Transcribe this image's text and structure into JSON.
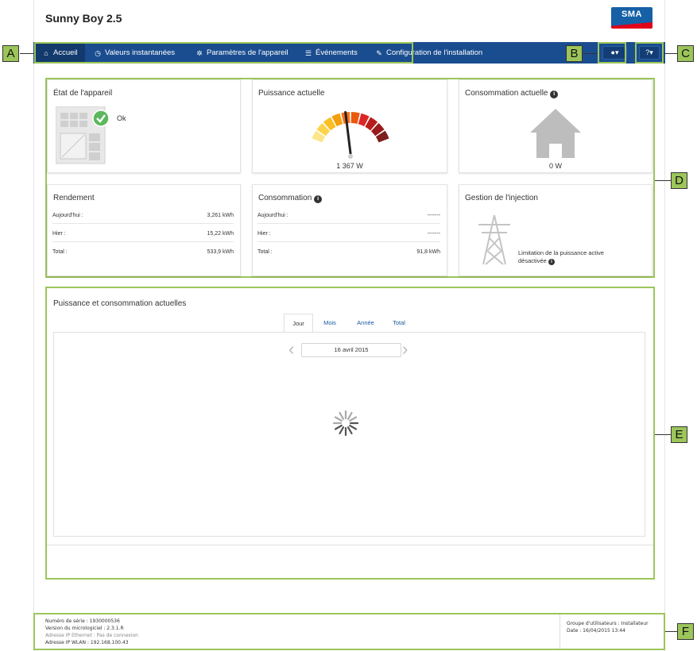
{
  "app": {
    "title": "Sunny Boy 2.5",
    "logo_text": "SMA"
  },
  "nav": {
    "items": [
      {
        "label": "Accueil",
        "icon": "home-icon",
        "active": true
      },
      {
        "label": "Valeurs instantanées",
        "icon": "clock-icon"
      },
      {
        "label": "Paramètres de l'appareil",
        "icon": "gear-icon"
      },
      {
        "label": "Événements",
        "icon": "list-icon"
      },
      {
        "label": "Configuration de l'installation",
        "icon": "wrench-icon"
      }
    ],
    "user_menu": "user-icon",
    "help_menu": "help-icon"
  },
  "callouts": [
    "A",
    "B",
    "C",
    "D",
    "E",
    "F"
  ],
  "tiles": {
    "device_state": {
      "title": "État de l'appareil",
      "status": "Ok",
      "icon": "check-circle-icon"
    },
    "current_power": {
      "title": "Puissance actuelle",
      "value": "1 367 W",
      "gauge_fraction": 0.45
    },
    "current_consumption": {
      "title": "Consommation actuelle",
      "info_icon": "info-icon",
      "value": "0 W"
    },
    "yield": {
      "title": "Rendement",
      "rows": [
        {
          "label": "Aujourd'hui :",
          "value": "3,261 kWh"
        },
        {
          "label": "Hier :",
          "value": "15,22 kWh"
        },
        {
          "label": "Total :",
          "value": "533,9 kWh"
        }
      ]
    },
    "consumption": {
      "title": "Consommation",
      "info_icon": "info-icon",
      "rows": [
        {
          "label": "Aujourd'hui :",
          "value": "-------"
        },
        {
          "label": "Hier :",
          "value": "-------"
        },
        {
          "label": "Total :",
          "value": "91,8 kWh"
        }
      ]
    },
    "feedin": {
      "title": "Gestion de l'injection",
      "line1": "Limitation de la puissance active",
      "line2": "désactivée",
      "info_icon": "info-icon"
    }
  },
  "chart_panel": {
    "title": "Puissance et consommation actuelles",
    "tabs": [
      "Jour",
      "Mois",
      "Année",
      "Total"
    ],
    "active_tab": "Jour",
    "date": "16 avril 2015",
    "loading": true
  },
  "footer": {
    "left": [
      "Numéro de série : 1930000536",
      "Version du micrologiciel : 2.3.1.R",
      "Adresse IP Ethernet : Pas de connexion",
      "Adresse IP WLAN : 192.168.100.43"
    ],
    "right": [
      "Groupe d'utilisateurs : Installateur",
      "Date : 16/04/2015 13:44"
    ]
  },
  "colors": {
    "nav": "#1a4d8f",
    "callout": "#9cc55a",
    "brand_blue": "#1560a6",
    "brand_red": "#e2001a"
  }
}
